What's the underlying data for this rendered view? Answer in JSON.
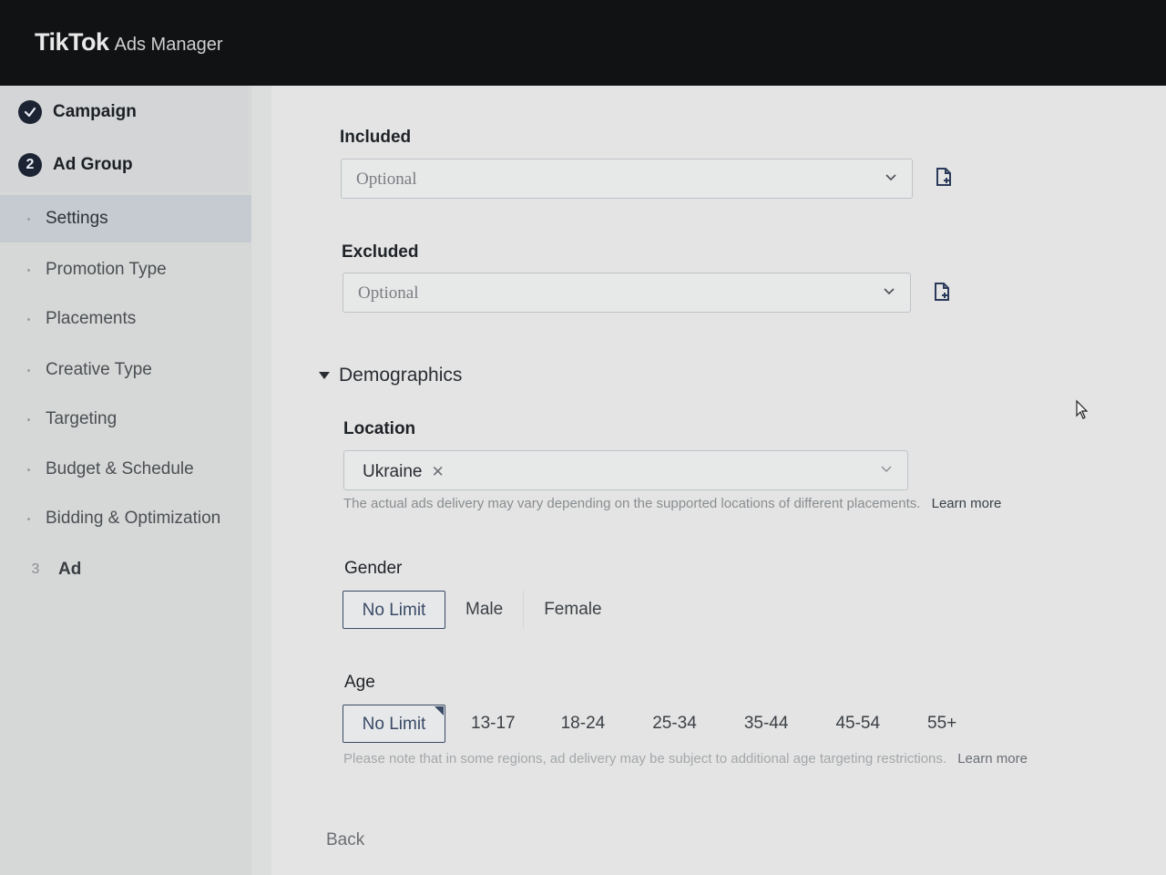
{
  "header": {
    "brand": "TikTok",
    "product": "Ads Manager"
  },
  "sidebar": {
    "steps": [
      {
        "label": "Campaign",
        "badge": "✓"
      },
      {
        "label": "Ad Group",
        "badge": "2"
      },
      {
        "label": "Ad",
        "badge": "3"
      }
    ],
    "items": [
      {
        "label": "Settings"
      },
      {
        "label": "Promotion Type"
      },
      {
        "label": "Placements"
      },
      {
        "label": "Creative Type"
      },
      {
        "label": "Targeting"
      },
      {
        "label": "Budget & Schedule"
      },
      {
        "label": "Bidding & Optimization"
      }
    ]
  },
  "form": {
    "included": {
      "label": "Included",
      "placeholder": "Optional"
    },
    "excluded": {
      "label": "Excluded",
      "placeholder": "Optional"
    },
    "demographics": {
      "label": "Demographics"
    },
    "location": {
      "label": "Location",
      "selected_tag": "Ukraine",
      "hint": "The actual ads delivery may vary depending on the supported locations of different placements.",
      "learn_more": "Learn more"
    },
    "gender": {
      "label": "Gender",
      "options": [
        "No Limit",
        "Male",
        "Female"
      ],
      "selected": "No Limit"
    },
    "age": {
      "label": "Age",
      "options": [
        "No Limit",
        "13-17",
        "18-24",
        "25-34",
        "35-44",
        "45-54",
        "55+"
      ],
      "selected": "No Limit",
      "hint": "Please note that in some regions, ad delivery may be subject to additional age targeting restrictions.",
      "learn_more": "Learn more"
    },
    "back_label": "Back"
  },
  "colors": {
    "header_bg": "#111214",
    "accent": "#1c2433"
  }
}
